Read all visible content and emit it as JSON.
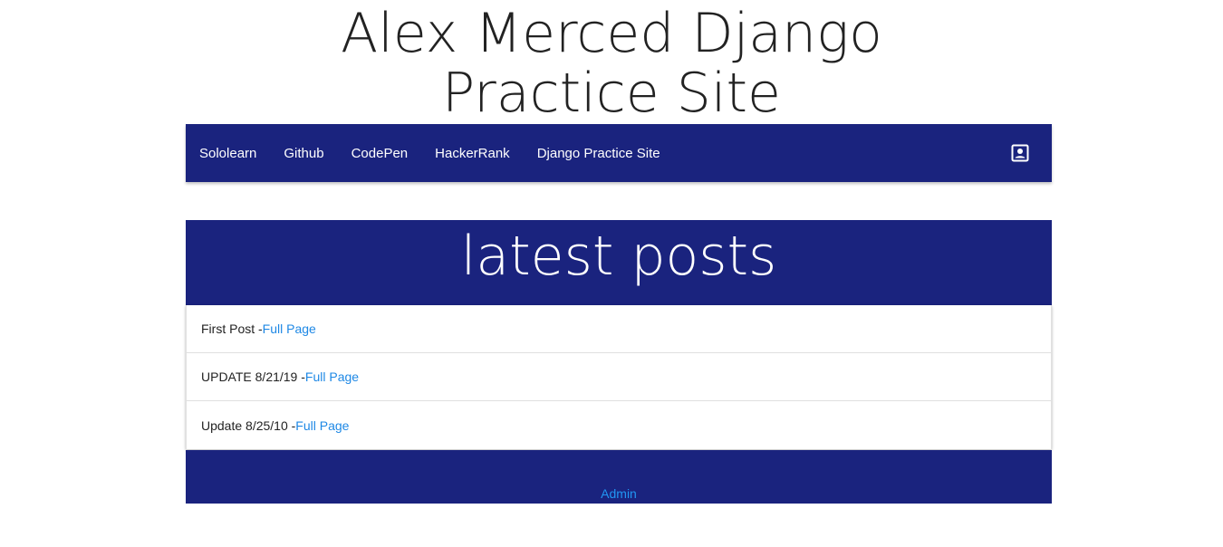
{
  "header": {
    "title_line1": "Alex Merced Django",
    "title_line2": "Practice Site"
  },
  "navbar": {
    "links": [
      "Sololearn",
      "Github",
      "CodePen",
      "HackerRank",
      "Django Practice Site"
    ],
    "account_icon": "account-box-icon",
    "color": "#1a237e"
  },
  "posts": {
    "heading": "latest posts",
    "items": [
      {
        "title": "First Post -",
        "link": "Full Page"
      },
      {
        "title": "UPDATE 8/21/19 -",
        "link": "Full Page"
      },
      {
        "title": "Update 8/25/10 -",
        "link": "Full Page"
      }
    ]
  },
  "footer": {
    "admin_label": "Admin"
  },
  "colors": {
    "primary": "#1a237e",
    "link": "#1e88e5"
  }
}
